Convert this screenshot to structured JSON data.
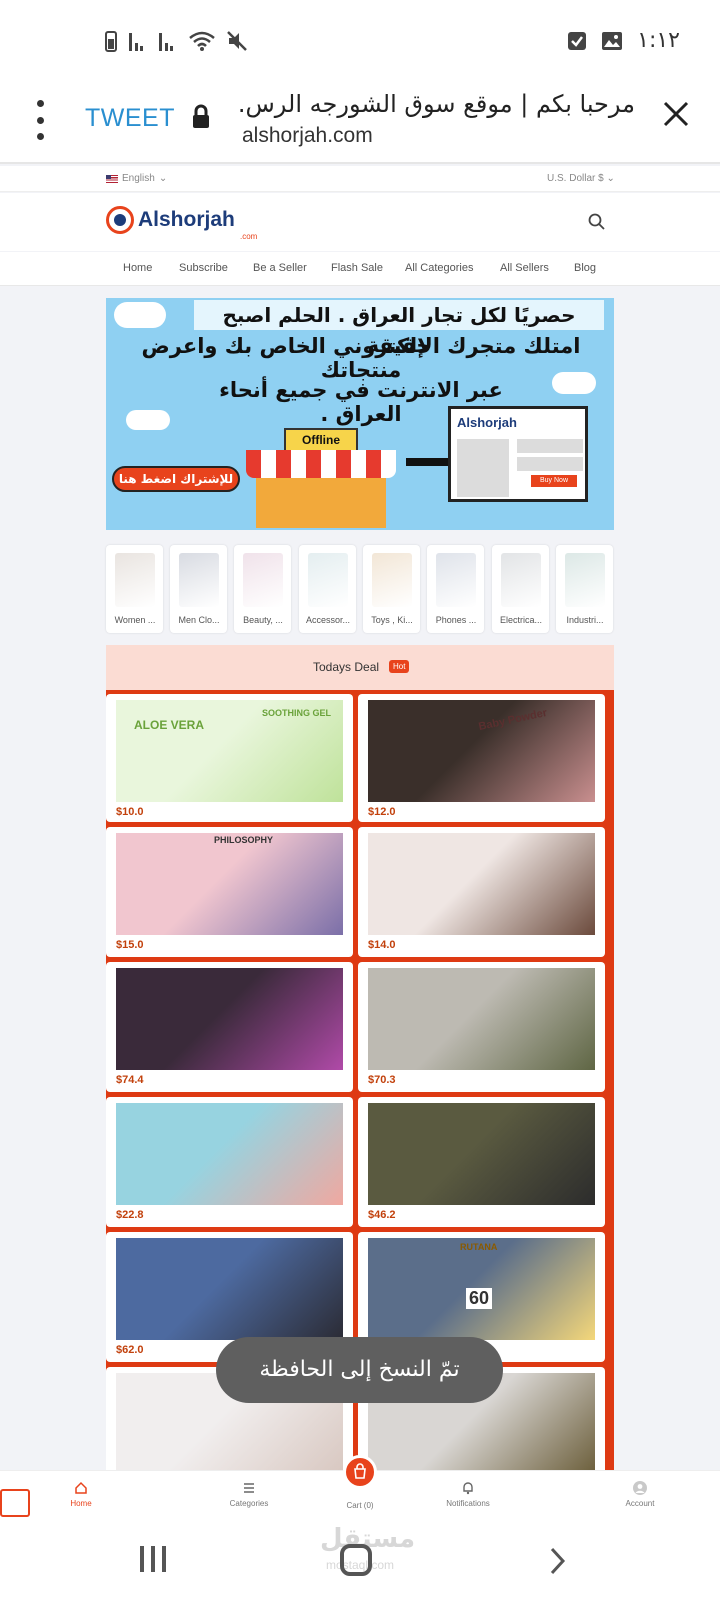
{
  "status_bar": {
    "time": "١:١٢",
    "icons": [
      "battery-icon",
      "signal-icon",
      "signal-icon",
      "wifi-icon",
      "mute-icon",
      "check-icon",
      "image-icon"
    ]
  },
  "browser": {
    "tweet_label": "TWEET",
    "title": "مرحبا بكم | موقع سوق الشورجه الرس..",
    "url": "alshorjah.com",
    "icons": [
      "more-vert-icon",
      "lock-icon",
      "close-icon"
    ]
  },
  "site": {
    "language": "English",
    "currency": "U.S. Dollar $",
    "logo_text": "Alshorjah",
    "logo_sub": ".com",
    "nav": [
      "Home",
      "Subscribe",
      "Be a Seller",
      "Flash Sale",
      "All Categories",
      "All Sellers",
      "Blog"
    ]
  },
  "banner": {
    "line1": "حصريًا لكل تجار العراق . الحلم اصبح حقيقة",
    "line2": "امتلك متجرك الإلكتروني الخاص بك واعرض منتجاتك",
    "line3": "عبر الانترنت في جميع أنحاء العراق .",
    "shop_sign": "Offline",
    "screen_brand": "Alshorjah",
    "screen_button": "Buy Now",
    "cta": "للإشتراك اضغط هنا"
  },
  "categories": [
    {
      "label": "Women ...",
      "color": "#e9e4e0"
    },
    {
      "label": "Men Clo...",
      "color": "#d8dbe2"
    },
    {
      "label": "Beauty, ...",
      "color": "#f0e2ea"
    },
    {
      "label": "Accessor...",
      "color": "#e4eef0"
    },
    {
      "label": "Toys , Ki...",
      "color": "#f2e6d6"
    },
    {
      "label": "Phones ...",
      "color": "#dfe3ea"
    },
    {
      "label": "Electrica...",
      "color": "#e2e4e6"
    },
    {
      "label": "Industri...",
      "color": "#dce8e6"
    }
  ],
  "deal": {
    "title": "Todays Deal",
    "badge": "Hot",
    "products": [
      {
        "price": "$10.0",
        "caption": "ALOE VERA",
        "caption2": "SOOTHING GEL",
        "colors": [
          "#e9f6dc",
          "#bfe29a"
        ]
      },
      {
        "price": "$12.0",
        "caption": "Baby Powder",
        "caption2": "",
        "colors": [
          "#3a2f2a",
          "#c98f8f"
        ]
      },
      {
        "price": "$15.0",
        "caption": "PHILOSOPHY",
        "caption2": "",
        "colors": [
          "#f1c6cf",
          "#7b6fa8"
        ]
      },
      {
        "price": "$14.0",
        "caption": "",
        "caption2": "",
        "colors": [
          "#efe6e3",
          "#6b4a3c"
        ]
      },
      {
        "price": "$74.4",
        "caption": "",
        "caption2": "",
        "colors": [
          "#3a2a3a",
          "#b04aa8"
        ]
      },
      {
        "price": "$70.3",
        "caption": "",
        "caption2": "",
        "colors": [
          "#bdbab2",
          "#5f6644"
        ]
      },
      {
        "price": "$22.8",
        "caption": "",
        "caption2": "",
        "colors": [
          "#97d3e0",
          "#f0a8a0"
        ]
      },
      {
        "price": "$46.2",
        "caption": "",
        "caption2": "",
        "colors": [
          "#5a5a40",
          "#2c2c2c"
        ]
      },
      {
        "price": "$62.0",
        "caption": "",
        "caption2": "",
        "colors": [
          "#4d6aa0",
          "#2b2b34"
        ]
      },
      {
        "price": "",
        "caption": "RUTANA",
        "caption2": "60",
        "colors": [
          "#5b6e8a",
          "#f4d77a"
        ]
      },
      {
        "price": "",
        "caption": "",
        "caption2": "",
        "colors": [
          "#f1eeee",
          "#d8c7c0"
        ]
      },
      {
        "price": "",
        "caption": "",
        "caption2": "",
        "colors": [
          "#d9d6d3",
          "#6b5e3a"
        ]
      }
    ]
  },
  "toast": "تمّ النسخ إلى الحافظة",
  "app_nav": {
    "items": [
      {
        "label": "Home",
        "icon": "home-icon",
        "active": true
      },
      {
        "label": "Categories",
        "icon": "list-icon",
        "active": false
      },
      {
        "label": "Cart (0)",
        "icon": "cart-icon",
        "active": false
      },
      {
        "label": "Notifications",
        "icon": "bell-icon",
        "active": false
      },
      {
        "label": "Account",
        "icon": "avatar-icon",
        "active": false
      }
    ]
  },
  "watermark": {
    "arabic": "مستقل",
    "latin": "mostaql.com"
  },
  "colors": {
    "accent": "#e8431c",
    "brand_blue": "#1d3c7a",
    "deal_bg": "#de3a13",
    "tweet": "#2a8fd0"
  }
}
